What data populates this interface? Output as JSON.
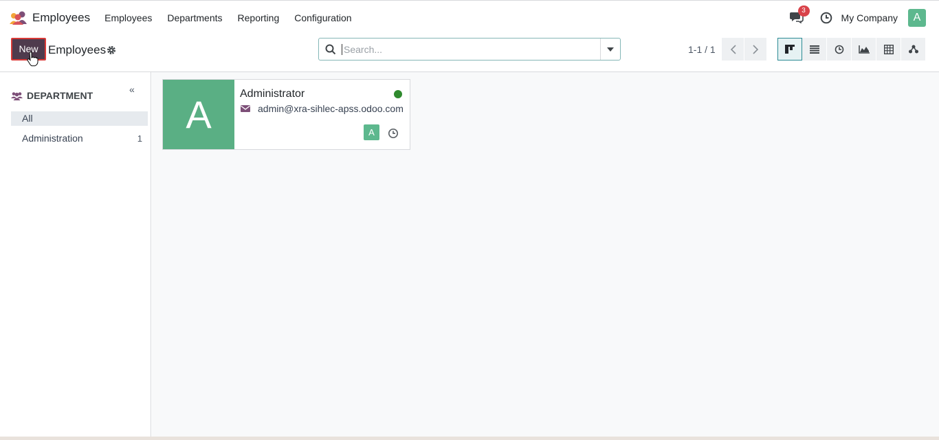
{
  "app": {
    "title": "Employees",
    "menu": [
      "Employees",
      "Departments",
      "Reporting",
      "Configuration"
    ],
    "notifications_count": "3",
    "company": "My Company",
    "user_initial": "A"
  },
  "control": {
    "new_label": "New",
    "breadcrumb": "Employees",
    "search_placeholder": "Search...",
    "pager": "1-1 / 1",
    "views": [
      "kanban-icon",
      "list-icon",
      "activity-icon",
      "graph-icon",
      "pivot-icon",
      "hierarchy-icon"
    ],
    "active_view": "kanban"
  },
  "sidebar": {
    "heading": "DEPARTMENT",
    "items": [
      {
        "label": "All",
        "count": ""
      },
      {
        "label": "Administration",
        "count": "1"
      }
    ]
  },
  "employee_card": {
    "initial": "A",
    "name": "Administrator",
    "email": "admin@xra-sihlec-apss.odoo.com",
    "status": "online",
    "user_initial": "A"
  },
  "colors": {
    "brand_purple": "#4f3b4d",
    "accent_teal": "#2b8a93",
    "photo_green": "#5aaf84",
    "online_green": "#2f8a2e",
    "badge_red": "#d9434a"
  }
}
